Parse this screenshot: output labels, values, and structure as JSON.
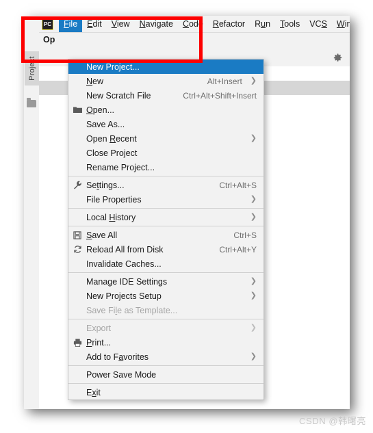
{
  "app": {
    "logo_text": "PC",
    "logo_name": "pycharm-logo-icon"
  },
  "menubar": {
    "items": [
      {
        "label": "File",
        "mnemonic": "F",
        "active": true
      },
      {
        "label": "Edit",
        "mnemonic": "E",
        "active": false
      },
      {
        "label": "View",
        "mnemonic": "V",
        "active": false
      },
      {
        "label": "Navigate",
        "mnemonic": "N",
        "active": false
      },
      {
        "label": "Code",
        "mnemonic": "C",
        "active": false
      },
      {
        "label": "Refactor",
        "mnemonic": "R",
        "active": false
      },
      {
        "label": "Run",
        "mnemonic": "u",
        "active": false
      },
      {
        "label": "Tools",
        "mnemonic": "T",
        "active": false
      },
      {
        "label": "VCS",
        "mnemonic": "S",
        "active": false
      },
      {
        "label": "Window",
        "mnemonic": "W",
        "active": false
      }
    ]
  },
  "toolbar": {
    "open_label": "Op"
  },
  "sidebar": {
    "stripe_label": "Project",
    "stripe_icon": "folder-icon"
  },
  "panel_header": {
    "gear_icon": "gear-icon"
  },
  "file_menu": {
    "items": [
      {
        "type": "item",
        "label": "New Project...",
        "mnemonic": "",
        "shortcut": "",
        "icon": "",
        "arrow": false,
        "selected": true,
        "disabled": false
      },
      {
        "type": "item",
        "label": "New",
        "mnemonic": "N",
        "shortcut": "Alt+Insert",
        "icon": "",
        "arrow": true,
        "selected": false,
        "disabled": false
      },
      {
        "type": "item",
        "label": "New Scratch File",
        "mnemonic": "",
        "shortcut": "Ctrl+Alt+Shift+Insert",
        "icon": "",
        "arrow": false,
        "selected": false,
        "disabled": false
      },
      {
        "type": "item",
        "label": "Open...",
        "mnemonic": "O",
        "shortcut": "",
        "icon": "folder-icon",
        "arrow": false,
        "selected": false,
        "disabled": false
      },
      {
        "type": "item",
        "label": "Save As...",
        "mnemonic": "",
        "shortcut": "",
        "icon": "",
        "arrow": false,
        "selected": false,
        "disabled": false
      },
      {
        "type": "item",
        "label": "Open Recent",
        "mnemonic": "R",
        "shortcut": "",
        "icon": "",
        "arrow": true,
        "selected": false,
        "disabled": false
      },
      {
        "type": "item",
        "label": "Close Project",
        "mnemonic": "",
        "shortcut": "",
        "icon": "",
        "arrow": false,
        "selected": false,
        "disabled": false
      },
      {
        "type": "item",
        "label": "Rename Project...",
        "mnemonic": "",
        "shortcut": "",
        "icon": "",
        "arrow": false,
        "selected": false,
        "disabled": false
      },
      {
        "type": "separator"
      },
      {
        "type": "item",
        "label": "Settings...",
        "mnemonic": "t",
        "shortcut": "Ctrl+Alt+S",
        "icon": "wrench-icon",
        "arrow": false,
        "selected": false,
        "disabled": false
      },
      {
        "type": "item",
        "label": "File Properties",
        "mnemonic": "",
        "shortcut": "",
        "icon": "",
        "arrow": true,
        "selected": false,
        "disabled": false
      },
      {
        "type": "separator"
      },
      {
        "type": "item",
        "label": "Local History",
        "mnemonic": "H",
        "shortcut": "",
        "icon": "",
        "arrow": true,
        "selected": false,
        "disabled": false
      },
      {
        "type": "separator"
      },
      {
        "type": "item",
        "label": "Save All",
        "mnemonic": "S",
        "shortcut": "Ctrl+S",
        "icon": "save-icon",
        "arrow": false,
        "selected": false,
        "disabled": false
      },
      {
        "type": "item",
        "label": "Reload All from Disk",
        "mnemonic": "",
        "shortcut": "Ctrl+Alt+Y",
        "icon": "reload-icon",
        "arrow": false,
        "selected": false,
        "disabled": false
      },
      {
        "type": "item",
        "label": "Invalidate Caches...",
        "mnemonic": "",
        "shortcut": "",
        "icon": "",
        "arrow": false,
        "selected": false,
        "disabled": false
      },
      {
        "type": "separator"
      },
      {
        "type": "item",
        "label": "Manage IDE Settings",
        "mnemonic": "",
        "shortcut": "",
        "icon": "",
        "arrow": true,
        "selected": false,
        "disabled": false
      },
      {
        "type": "item",
        "label": "New Projects Setup",
        "mnemonic": "",
        "shortcut": "",
        "icon": "",
        "arrow": true,
        "selected": false,
        "disabled": false
      },
      {
        "type": "item",
        "label": "Save File as Template...",
        "mnemonic": "l",
        "shortcut": "",
        "icon": "",
        "arrow": false,
        "selected": false,
        "disabled": true
      },
      {
        "type": "separator"
      },
      {
        "type": "item",
        "label": "Export",
        "mnemonic": "",
        "shortcut": "",
        "icon": "",
        "arrow": true,
        "selected": false,
        "disabled": true
      },
      {
        "type": "item",
        "label": "Print...",
        "mnemonic": "P",
        "shortcut": "",
        "icon": "print-icon",
        "arrow": false,
        "selected": false,
        "disabled": false
      },
      {
        "type": "item",
        "label": "Add to Favorites",
        "mnemonic": "a",
        "shortcut": "",
        "icon": "",
        "arrow": true,
        "selected": false,
        "disabled": false
      },
      {
        "type": "separator"
      },
      {
        "type": "item",
        "label": "Power Save Mode",
        "mnemonic": "",
        "shortcut": "",
        "icon": "",
        "arrow": false,
        "selected": false,
        "disabled": false
      },
      {
        "type": "separator"
      },
      {
        "type": "item",
        "label": "Exit",
        "mnemonic": "x",
        "shortcut": "",
        "icon": "",
        "arrow": false,
        "selected": false,
        "disabled": false
      }
    ]
  },
  "annotation": {
    "color": "#fd0000",
    "shape": "rectangle"
  },
  "watermark": {
    "text": "CSDN @韩曙亮"
  }
}
